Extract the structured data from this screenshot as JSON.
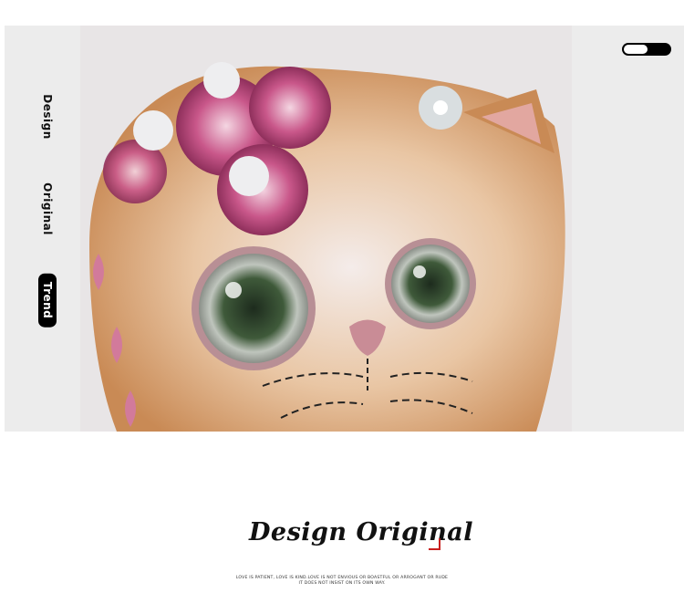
{
  "sidebar": {
    "items": [
      {
        "label": "Design",
        "active": false
      },
      {
        "label": "Original",
        "active": false
      },
      {
        "label": "Trend",
        "active": true
      }
    ]
  },
  "hero": {
    "image_subject": "cat illustration with pink flowers and sequin embellishments"
  },
  "headline": "Design Original",
  "caption": {
    "line1": "LOVE IS PATIENT, LOVE IS KIND.LOVE IS NOT ENVIOUS OR BOASTFUL OR ARROGANT OR RUDE",
    "line2": "IT DOES NOT INSIST ON ITS OWN WAY."
  },
  "colors": {
    "panel": "#ececec",
    "accent_red": "#c8201f",
    "text": "#111111"
  }
}
